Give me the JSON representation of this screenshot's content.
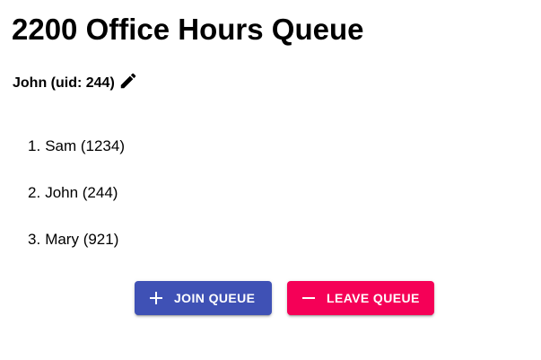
{
  "page": {
    "title": "2200 Office Hours Queue"
  },
  "user": {
    "label": "John (uid: 244)",
    "edit_icon": "pencil-icon"
  },
  "queue": {
    "items": [
      {
        "number": "1.",
        "text": "Sam (1234)"
      },
      {
        "number": "2.",
        "text": "John (244)"
      },
      {
        "number": "3.",
        "text": "Mary (921)"
      }
    ]
  },
  "actions": {
    "join_label": "JOIN QUEUE",
    "join_icon": "plus-icon",
    "join_color": "#3f51b5",
    "leave_label": "LEAVE QUEUE",
    "leave_icon": "minus-icon",
    "leave_color": "#f50057"
  }
}
